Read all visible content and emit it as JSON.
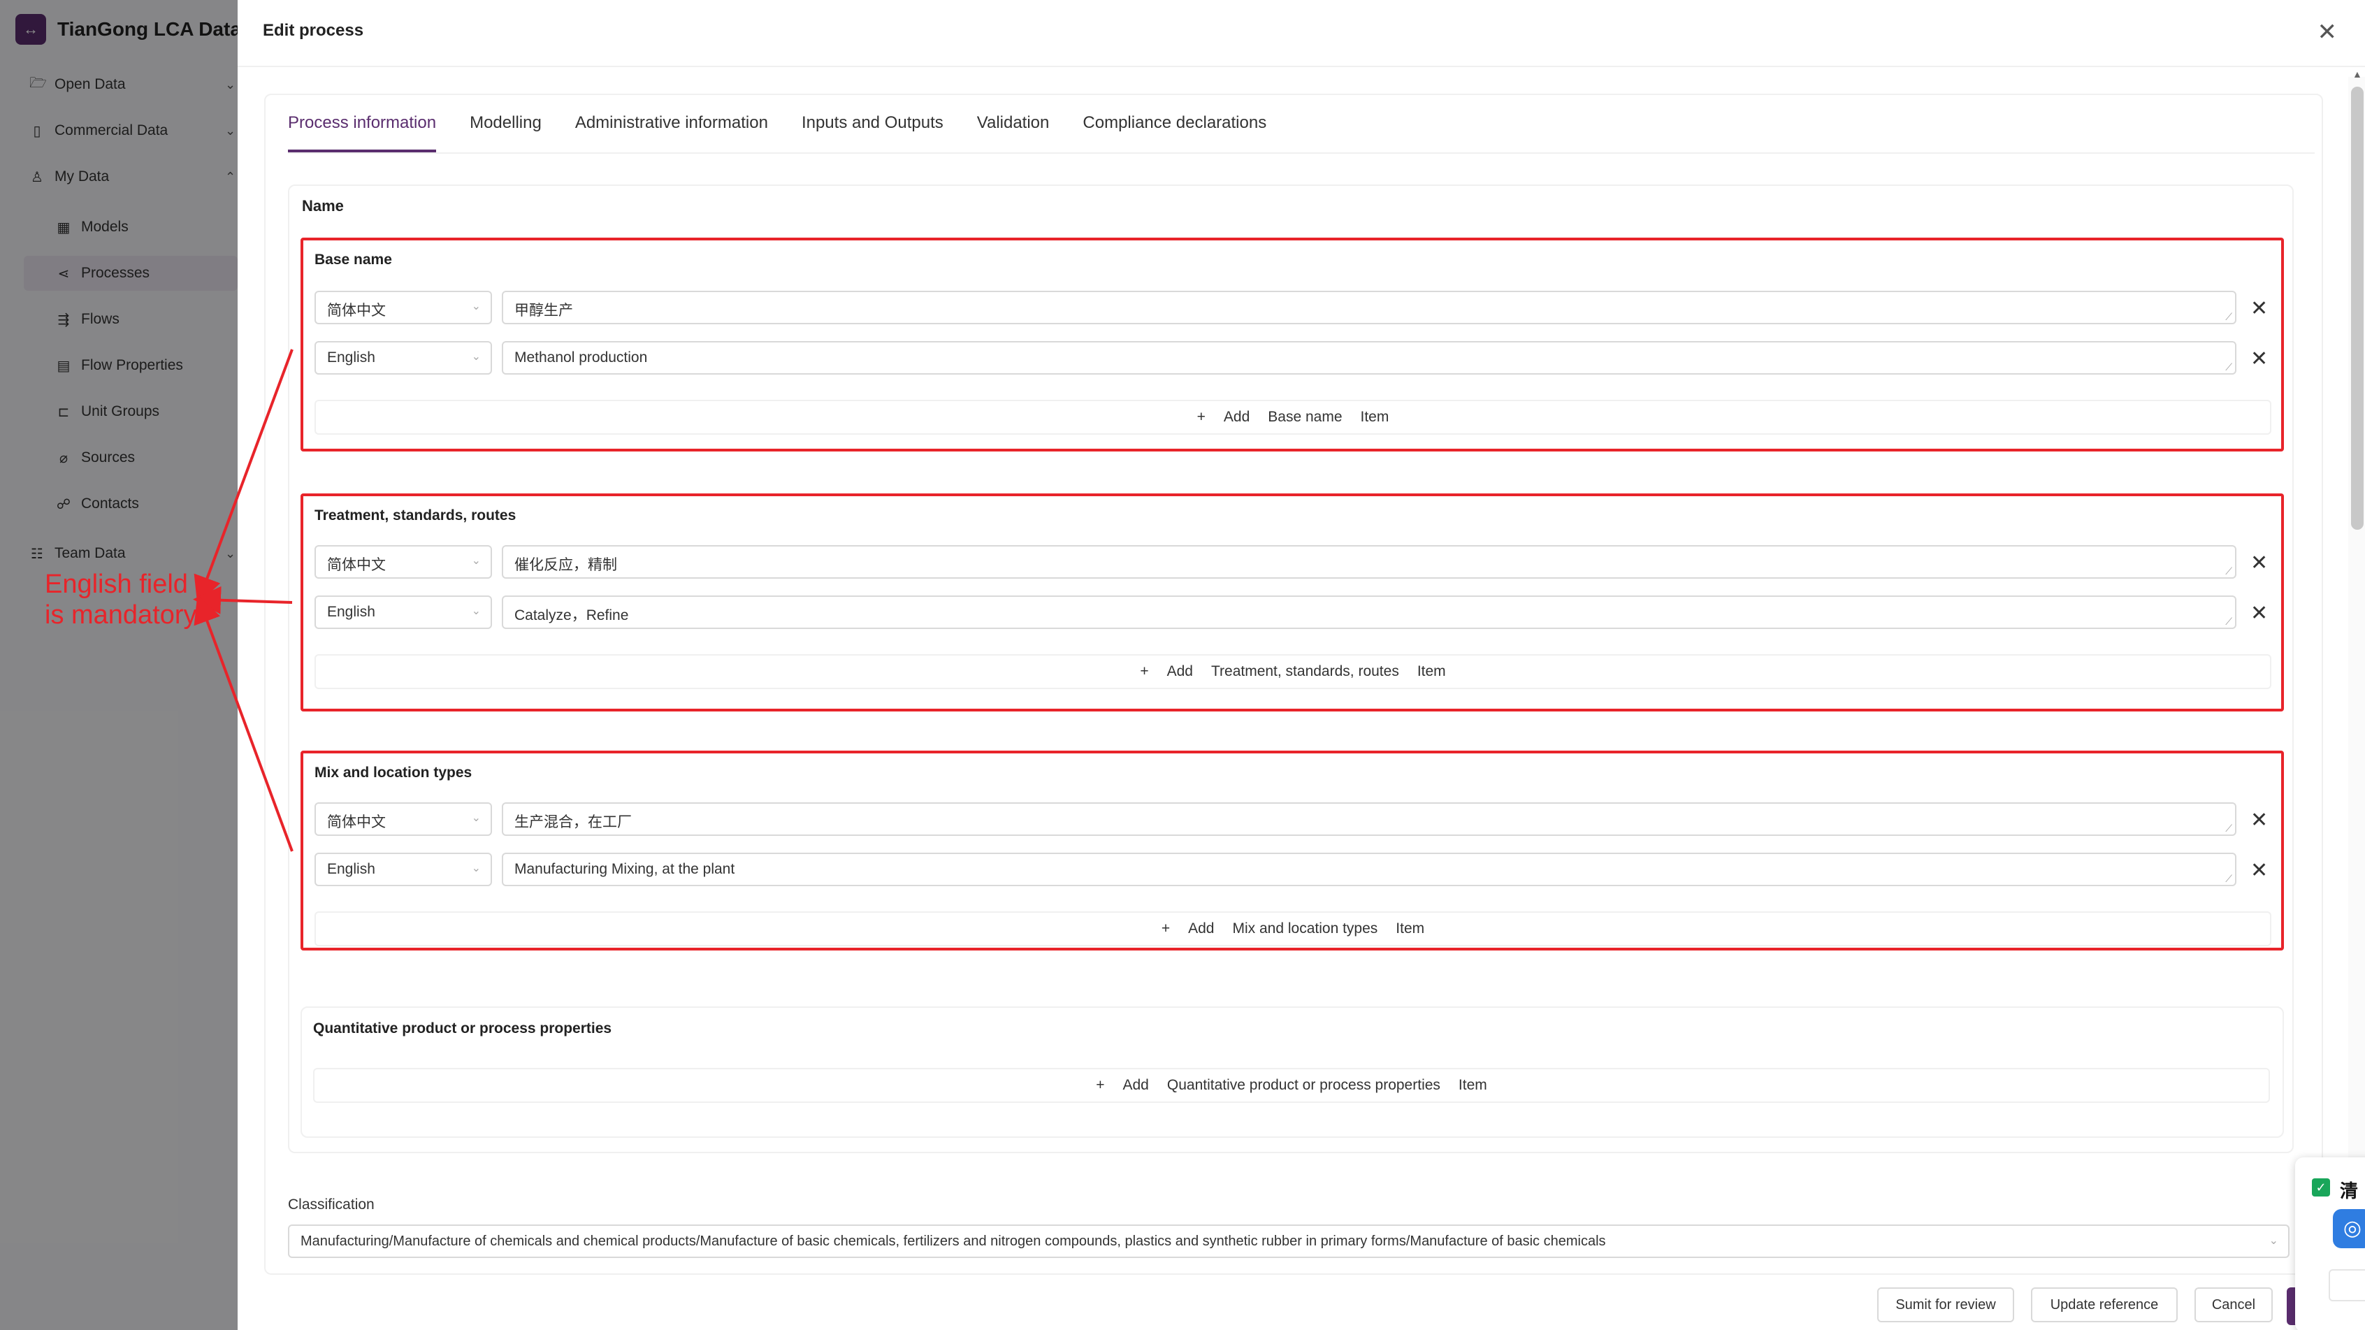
{
  "app": {
    "brand_logo": "↔",
    "title": "TianGong LCA Data P"
  },
  "sidebar": {
    "items": [
      {
        "label": "Open Data",
        "icon": "folder-open-icon",
        "glyph": "🗁",
        "chevron": "⌄"
      },
      {
        "label": "Commercial Data",
        "icon": "document-icon",
        "glyph": "▯",
        "chevron": "⌄"
      },
      {
        "label": "My Data",
        "icon": "user-icon",
        "glyph": "♙",
        "chevron": "⌃"
      },
      {
        "label": "Models",
        "icon": "models-icon",
        "glyph": "▦"
      },
      {
        "label": "Processes",
        "icon": "share-nodes-icon",
        "glyph": "⋖"
      },
      {
        "label": "Flows",
        "icon": "flows-icon",
        "glyph": "⇶"
      },
      {
        "label": "Flow Properties",
        "icon": "table-icon",
        "glyph": "▤"
      },
      {
        "label": "Unit Groups",
        "icon": "unit-groups-icon",
        "glyph": "⊏"
      },
      {
        "label": "Sources",
        "icon": "paperclip-icon",
        "glyph": "⌀"
      },
      {
        "label": "Contacts",
        "icon": "contacts-icon",
        "glyph": "☍"
      },
      {
        "label": "Team Data",
        "icon": "team-icon",
        "glyph": "☷",
        "chevron": "⌄"
      }
    ]
  },
  "drawer": {
    "title": "Edit process",
    "close_glyph": "✕"
  },
  "tabs": [
    {
      "label": "Process information",
      "active": true
    },
    {
      "label": "Modelling"
    },
    {
      "label": "Administrative information"
    },
    {
      "label": "Inputs and Outputs"
    },
    {
      "label": "Validation"
    },
    {
      "label": "Compliance declarations"
    }
  ],
  "name_section": {
    "label": "Name",
    "groups": [
      {
        "title": "Base name",
        "rows": [
          {
            "lang": "简体中文",
            "value": "甲醇生产"
          },
          {
            "lang": "English",
            "value": "Methanol production"
          }
        ],
        "add": {
          "plus": "+",
          "add": "Add",
          "name": "Base name",
          "item": "Item"
        }
      },
      {
        "title": "Treatment, standards, routes",
        "rows": [
          {
            "lang": "简体中文",
            "value": "催化反应，精制"
          },
          {
            "lang": "English",
            "value": "Catalyze，Refine"
          }
        ],
        "add": {
          "plus": "+",
          "add": "Add",
          "name": "Treatment, standards, routes",
          "item": "Item"
        }
      },
      {
        "title": "Mix and location types",
        "rows": [
          {
            "lang": "简体中文",
            "value": "生产混合，在工厂"
          },
          {
            "lang": "English",
            "value": "Manufacturing Mixing, at the plant"
          }
        ],
        "add": {
          "plus": "+",
          "add": "Add",
          "name": "Mix and location types",
          "item": "Item"
        }
      },
      {
        "title": "Quantitative product or process properties",
        "rows": [],
        "add": {
          "plus": "+",
          "add": "Add",
          "name": "Quantitative product or process properties",
          "item": "Item"
        }
      }
    ]
  },
  "remove_glyph": "✕",
  "select_arrow": "⌄",
  "resize_grip": "⟋",
  "classification": {
    "label": "Classification",
    "value": "Manufacturing/Manufacture of chemicals and chemical products/Manufacture of basic chemicals, fertilizers and nitrogen compounds, plastics and synthetic rubber in primary forms/Manufacture of basic chemicals"
  },
  "footer": {
    "submit_review": "Sumit for review",
    "update_reference": "Update reference",
    "cancel": "Cancel"
  },
  "widget": {
    "check_glyph": "✓",
    "text": "清",
    "logo_glyph": "◎"
  },
  "annotation": {
    "line1": "English field",
    "line2": "is mandatory",
    "color": "#e8242a"
  },
  "colors": {
    "accent": "#5a2d6e",
    "highlight": "#e8242a"
  }
}
